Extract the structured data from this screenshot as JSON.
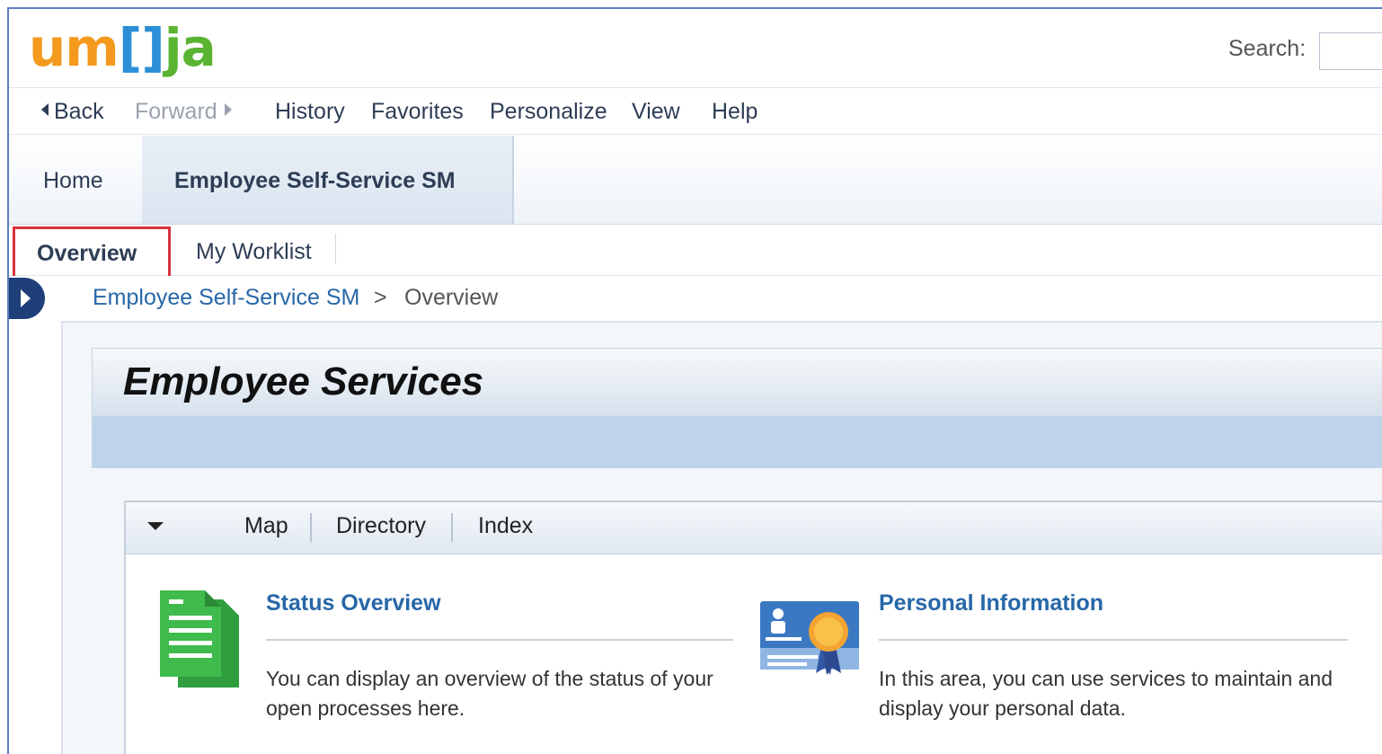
{
  "brand": {
    "logo_part1": "um",
    "logo_part2": "[]",
    "logo_part3": "ja",
    "colors": {
      "orange": "#f39a1e",
      "blue": "#2a8fd6",
      "green": "#5ab431"
    }
  },
  "search": {
    "label": "Search:",
    "value": ""
  },
  "nav": {
    "back": "Back",
    "forward": "Forward",
    "history": "History",
    "favorites": "Favorites",
    "personalize": "Personalize",
    "view": "View",
    "help": "Help"
  },
  "tabs": {
    "home": "Home",
    "active": "Employee Self-Service SM"
  },
  "subtabs": {
    "overview": "Overview",
    "worklist": "My Worklist",
    "highlight_color": "#d8323c"
  },
  "breadcrumb": {
    "parent": "Employee Self-Service SM",
    "separator": ">",
    "current": "Overview"
  },
  "page": {
    "title": "Employee Services"
  },
  "panel": {
    "tabs": [
      "Map",
      "Directory",
      "Index"
    ],
    "services": [
      {
        "title": "Status Overview",
        "description": "You can display an overview of the status of your open processes here.",
        "icon": "document-stack-icon"
      },
      {
        "title": "Personal Information",
        "description": "In this area, you can use services to maintain and display your personal data.",
        "icon": "id-card-ribbon-icon"
      }
    ]
  }
}
